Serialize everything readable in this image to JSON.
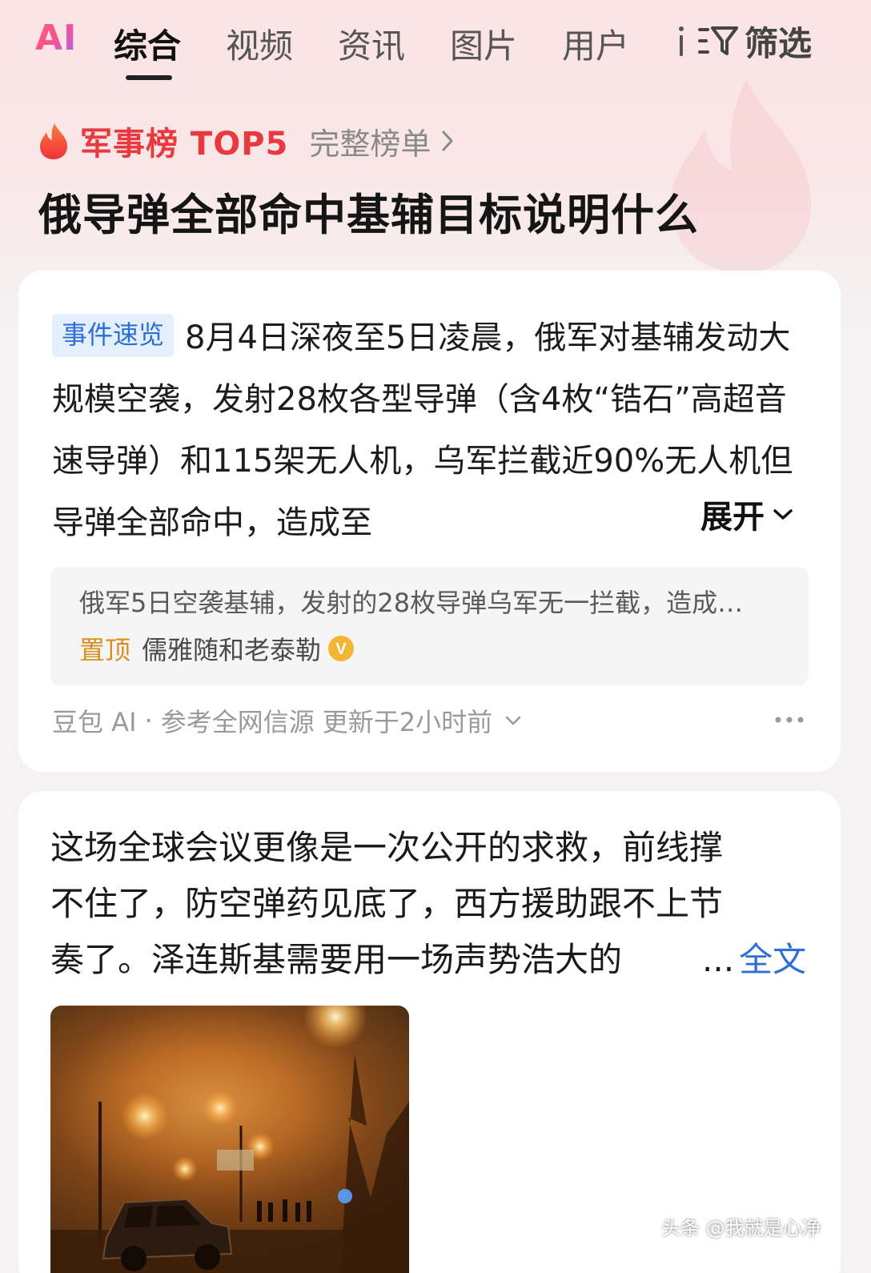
{
  "tabs": {
    "ai_label": "AI",
    "items": [
      "综合",
      "视频",
      "资讯",
      "图片",
      "用户"
    ],
    "filter_label": "筛选"
  },
  "hot_list": {
    "icon": "flame-icon",
    "title": "军事榜 TOP5",
    "full_list_label": "完整榜单"
  },
  "query_title": "俄导弹全部命中基辅目标说明什么",
  "ai_summary": {
    "tag": "事件速览",
    "text": "8月4日深夜至5日凌晨，俄军对基辅发动大规模空袭，发射28枚各型导弹（含4枚“锆石”高超音速导弹）和115架无人机，乌军拦截近90%无人机但导弹全部命中，造成至",
    "expand_label": "展开",
    "quote": {
      "text": "俄军5日空袭基辅，发射的28枚导弹乌军无一拦截，造成…",
      "pin_label": "置顶",
      "author": "儒雅随和老泰勒",
      "verified_badge": "V"
    },
    "footer": {
      "source": "豆包 AI",
      "separator": "·",
      "reference": "参考全网信源",
      "updated": "更新于2小时前"
    }
  },
  "article": {
    "lines": [
      "这场全球会议更像是一次公开的求救，前线撑",
      "不住了，防空弹药见底了，西方援助跟不上节",
      "奏了。泽连斯基需要用一场声势浩大的"
    ],
    "ellipsis": "...",
    "full_text_label": "全文"
  },
  "watermark": "头条 @我就是心净",
  "colors": {
    "accent_red": "#e8393f",
    "link_blue": "#2d6fd8",
    "pin_orange": "#d98f1f",
    "verified_yellow": "#f2b632"
  }
}
